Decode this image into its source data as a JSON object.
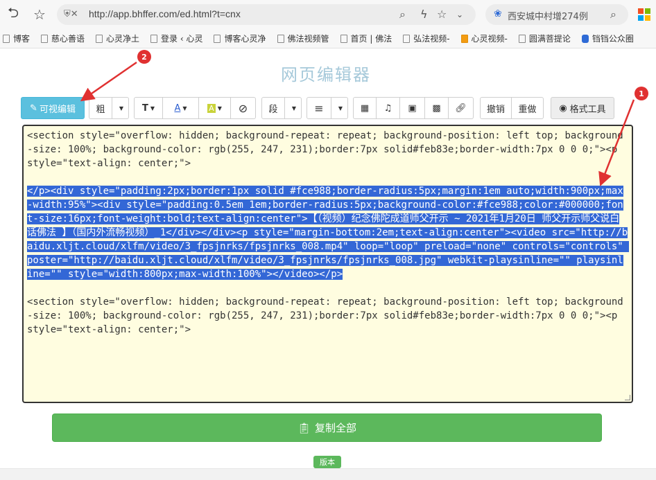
{
  "browser": {
    "url": "http://app.bhffer.com/ed.html?t=cnx",
    "search_text": "西安城中村增274例",
    "bookmarks": [
      {
        "label": "博客",
        "icon": "doc"
      },
      {
        "label": "慈心善语",
        "icon": "doc"
      },
      {
        "label": "心灵净土",
        "icon": "doc"
      },
      {
        "label": "登录 ‹ 心灵",
        "icon": "doc"
      },
      {
        "label": "博客心灵净",
        "icon": "doc"
      },
      {
        "label": "佛法视频管",
        "icon": "doc"
      },
      {
        "label": "首页 | 佛法",
        "icon": "doc"
      },
      {
        "label": "弘法视频-",
        "icon": "doc"
      },
      {
        "label": "心灵视频-",
        "icon": "orange"
      },
      {
        "label": "圆满菩提论",
        "icon": "doc"
      },
      {
        "label": "铛铛公众圈",
        "icon": "blue"
      }
    ]
  },
  "page": {
    "title": "网页编辑器"
  },
  "toolbar": {
    "visual_edit": "可视编辑",
    "bold": "粗",
    "font_size": "T",
    "font_color": "A",
    "bg_color": "A",
    "clear": "⊘",
    "paragraph": "段",
    "align": "≡",
    "undo": "撤销",
    "redo": "重做",
    "format_tool": "格式工具"
  },
  "editor": {
    "line1": "<section style=\"overflow: hidden; background-repeat: repeat; background-position: left top; background-size: 100%; background-color: rgb(255, 247, 231);border:7px solid#feb83e;border-width:7px 0 0 0;\"><p style=\"text-align: center;\">",
    "selected": "</p><div style=\"padding:2px;border:1px solid #fce988;border-radius:5px;margin:1em auto;width:900px;max-width:95%\"><div style=\"padding:0.5em 1em;border-radius:5px;background-color:#fce988;color:#000000;font-size:16px;font-weight:bold;text-align:center\">【（视频）纪念佛陀成道师父开示 ~ 2021年1月20日 师父开示师父说白话佛法 】（国内外流畅视频）_1</div></div><p style=\"margin-bottom:2em;text-align:center\"><video src=\"http://baidu.xljt.cloud/xlfm/video/3_fpsjnrks/fpsjnrks_008.mp4\" loop=\"loop\" preload=\"none\" controls=\"controls\" poster=\"http://baidu.xljt.cloud/xlfm/video/3_fpsjnrks/fpsjnrks_008.jpg\" webkit-playsinline=\"\" playsinline=\"\" style=\"width:800px;max-width:100%\"></video></p>",
    "line3": "<section style=\"overflow: hidden; background-repeat: repeat; background-position: left top; background-size: 100%; background-color: rgb(255, 247, 231);border:7px solid#feb83e;border-width:7px 0 0 0;\"><p style=\"text-align: center;\">"
  },
  "copy_all": "复制全部",
  "version": "版本",
  "annotations": {
    "badge1": "1",
    "badge2": "2"
  },
  "colors": {
    "visual_btn": "#5bc0de",
    "copy_btn": "#5cb85c",
    "selection": "#3367d6",
    "annotation": "#e03131",
    "title": "#a6c9da"
  }
}
